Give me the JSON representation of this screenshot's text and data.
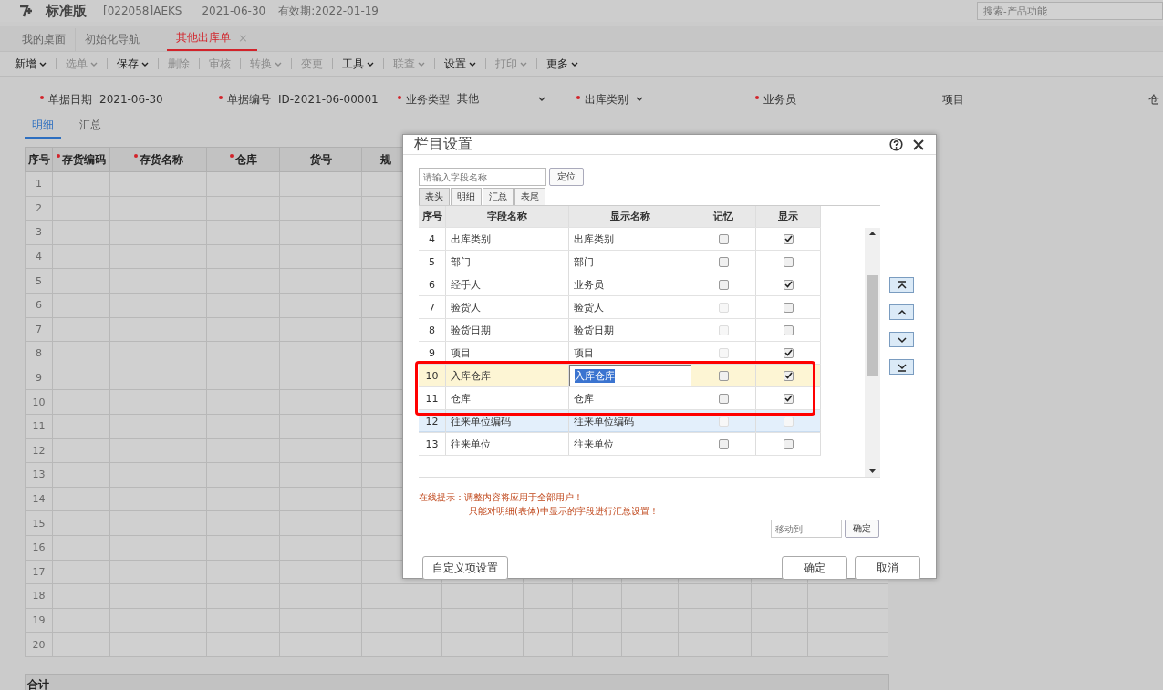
{
  "header": {
    "product": "标准版",
    "account": "[022058]AEKS",
    "date": "2021-06-30",
    "validity": "有效期:2022-01-19",
    "search_placeholder": "搜索-产品功能"
  },
  "tabs": [
    {
      "label": "我的桌面",
      "selected": false,
      "closable": false
    },
    {
      "label": "初始化导航",
      "selected": false,
      "closable": false
    },
    {
      "label": "其他出库单",
      "selected": true,
      "closable": true,
      "close": "×"
    }
  ],
  "toolbar": [
    {
      "label": "新增",
      "dropdown": true,
      "disabled": false
    },
    {
      "label": "选单",
      "dropdown": true,
      "disabled": true
    },
    {
      "label": "保存",
      "dropdown": true,
      "disabled": false
    },
    {
      "label": "删除",
      "dropdown": false,
      "disabled": true
    },
    {
      "label": "审核",
      "dropdown": false,
      "disabled": true
    },
    {
      "label": "转换",
      "dropdown": true,
      "disabled": true
    },
    {
      "label": "变更",
      "dropdown": false,
      "disabled": true
    },
    {
      "label": "工具",
      "dropdown": true,
      "disabled": false
    },
    {
      "label": "联查",
      "dropdown": true,
      "disabled": true
    },
    {
      "label": "设置",
      "dropdown": true,
      "disabled": false
    },
    {
      "label": "打印",
      "dropdown": true,
      "disabled": true
    },
    {
      "label": "更多",
      "dropdown": true,
      "disabled": false
    }
  ],
  "form": [
    {
      "label": "单据日期",
      "required": true,
      "value": "2021-06-30",
      "kind": "text"
    },
    {
      "label": "单据编号",
      "required": true,
      "value": "ID-2021-06-00001",
      "kind": "text"
    },
    {
      "label": "业务类型",
      "required": true,
      "value": "其他",
      "kind": "select"
    },
    {
      "label": "出库类别",
      "required": true,
      "kind": "select"
    },
    {
      "label": "业务员",
      "required": true,
      "kind": "text"
    },
    {
      "label": "项目",
      "required": false,
      "kind": "text"
    },
    {
      "label": "仓",
      "required": false,
      "kind": "cut"
    }
  ],
  "sub_tabs": [
    {
      "label": "明细",
      "selected": true
    },
    {
      "label": "汇总",
      "selected": false
    }
  ],
  "grid": {
    "columns": [
      {
        "label": "序号",
        "required": false
      },
      {
        "label": "存货编码",
        "required": true
      },
      {
        "label": "存货名称",
        "required": true
      },
      {
        "label": "仓库",
        "required": true
      },
      {
        "label": "货号",
        "required": false
      },
      {
        "label": "规",
        "required": false
      }
    ],
    "row_numbers": [
      "1",
      "2",
      "3",
      "4",
      "5",
      "6",
      "7",
      "8",
      "9",
      "10",
      "11",
      "12",
      "13",
      "14",
      "15",
      "16",
      "17",
      "18",
      "19",
      "20"
    ],
    "total_label": "合计"
  },
  "dialog": {
    "title": "栏目设置",
    "search_placeholder": "请输入字段名称",
    "locate_button": "定位",
    "tabs": [
      {
        "label": "表头",
        "selected": true
      },
      {
        "label": "明细",
        "selected": false
      },
      {
        "label": "汇总",
        "selected": false
      },
      {
        "label": "表尾",
        "selected": false
      }
    ],
    "columns": [
      "序号",
      "字段名称",
      "显示名称",
      "记忆",
      "显示"
    ],
    "rows": [
      {
        "no": "4",
        "field": "出库类别",
        "display": "出库类别",
        "memory": {
          "checked": false,
          "disabled": false
        },
        "show": {
          "checked": true,
          "disabled": false
        },
        "selected": false,
        "hovered": false,
        "editing": false,
        "boxed": false
      },
      {
        "no": "5",
        "field": "部门",
        "display": "部门",
        "memory": {
          "checked": false,
          "disabled": false
        },
        "show": {
          "checked": false,
          "disabled": false
        },
        "selected": false,
        "hovered": false,
        "editing": false,
        "boxed": false
      },
      {
        "no": "6",
        "field": "经手人",
        "display": "业务员",
        "memory": {
          "checked": false,
          "disabled": false
        },
        "show": {
          "checked": true,
          "disabled": false
        },
        "selected": false,
        "hovered": false,
        "editing": false,
        "boxed": false
      },
      {
        "no": "7",
        "field": "验货人",
        "display": "验货人",
        "memory": {
          "checked": false,
          "disabled": true
        },
        "show": {
          "checked": false,
          "disabled": false
        },
        "selected": false,
        "hovered": false,
        "editing": false,
        "boxed": false
      },
      {
        "no": "8",
        "field": "验货日期",
        "display": "验货日期",
        "memory": {
          "checked": false,
          "disabled": true
        },
        "show": {
          "checked": false,
          "disabled": false
        },
        "selected": false,
        "hovered": false,
        "editing": false,
        "boxed": false
      },
      {
        "no": "9",
        "field": "项目",
        "display": "项目",
        "memory": {
          "checked": false,
          "disabled": true
        },
        "show": {
          "checked": true,
          "disabled": false
        },
        "selected": false,
        "hovered": false,
        "editing": false,
        "boxed": false
      },
      {
        "no": "10",
        "field": "入库仓库",
        "display": "入库仓库",
        "memory": {
          "checked": false,
          "disabled": false
        },
        "show": {
          "checked": true,
          "disabled": false
        },
        "selected": true,
        "hovered": false,
        "editing": true,
        "boxed": true
      },
      {
        "no": "11",
        "field": "仓库",
        "display": "仓库",
        "memory": {
          "checked": false,
          "disabled": false
        },
        "show": {
          "checked": true,
          "disabled": false
        },
        "selected": false,
        "hovered": false,
        "editing": false,
        "boxed": true
      },
      {
        "no": "12",
        "field": "往来单位编码",
        "display": "往来单位编码",
        "memory": {
          "checked": false,
          "disabled": true
        },
        "show": {
          "checked": false,
          "disabled": true
        },
        "selected": false,
        "hovered": true,
        "editing": false,
        "boxed": false
      },
      {
        "no": "13",
        "field": "往来单位",
        "display": "往来单位",
        "memory": {
          "checked": false,
          "disabled": false
        },
        "show": {
          "checked": false,
          "disabled": false
        },
        "selected": false,
        "hovered": false,
        "editing": false,
        "boxed": false
      }
    ],
    "tips": [
      "在线提示：调整内容将应用于全部用户！",
      "只能对明细(表体)中显示的字段进行汇总设置！"
    ],
    "move_to_placeholder": "移动到",
    "move_confirm": "确定",
    "custom_button": "自定义项设置",
    "ok_button": "确定",
    "cancel_button": "取消"
  }
}
